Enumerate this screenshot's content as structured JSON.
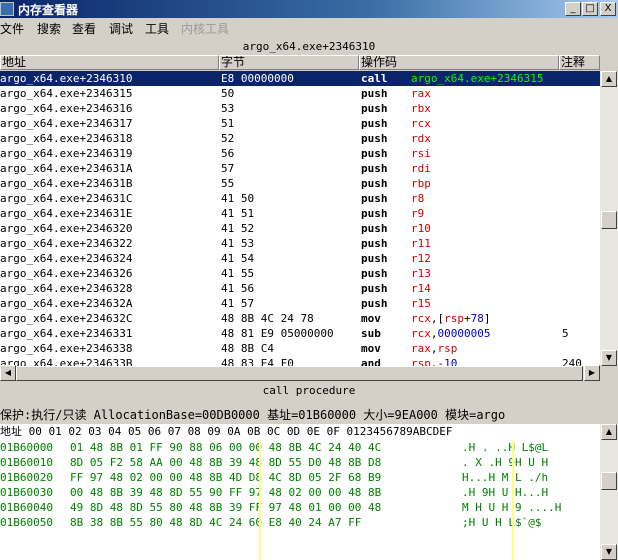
{
  "window": {
    "title": "内存查看器",
    "min": "_",
    "max": "□",
    "close": "X"
  },
  "menu": [
    "文件",
    "搜索",
    "查看",
    "调试",
    "工具",
    "内核工具"
  ],
  "disasm": {
    "header": "argo_x64.exe+2346310",
    "columns": {
      "address": "地址",
      "bytes": "字节",
      "opcode": "操作码",
      "comment": "注释"
    },
    "rows": [
      {
        "addr": "argo_x64.exe+2346310",
        "bytes": "E8 00000000",
        "op": "call",
        "args": [
          {
            "t": "argo_x64.exe+2346315",
            "k": "sel"
          }
        ],
        "cmt": ""
      },
      {
        "addr": "argo_x64.exe+2346315",
        "bytes": "50",
        "op": "push",
        "args": [
          {
            "t": "rax",
            "k": "reg"
          }
        ],
        "cmt": ""
      },
      {
        "addr": "argo_x64.exe+2346316",
        "bytes": "53",
        "op": "push",
        "args": [
          {
            "t": "rbx",
            "k": "reg"
          }
        ],
        "cmt": ""
      },
      {
        "addr": "argo_x64.exe+2346317",
        "bytes": "51",
        "op": "push",
        "args": [
          {
            "t": "rcx",
            "k": "reg"
          }
        ],
        "cmt": ""
      },
      {
        "addr": "argo_x64.exe+2346318",
        "bytes": "52",
        "op": "push",
        "args": [
          {
            "t": "rdx",
            "k": "reg"
          }
        ],
        "cmt": ""
      },
      {
        "addr": "argo_x64.exe+2346319",
        "bytes": "56",
        "op": "push",
        "args": [
          {
            "t": "rsi",
            "k": "reg"
          }
        ],
        "cmt": ""
      },
      {
        "addr": "argo_x64.exe+234631A",
        "bytes": "57",
        "op": "push",
        "args": [
          {
            "t": "rdi",
            "k": "reg"
          }
        ],
        "cmt": ""
      },
      {
        "addr": "argo_x64.exe+234631B",
        "bytes": "55",
        "op": "push",
        "args": [
          {
            "t": "rbp",
            "k": "reg"
          }
        ],
        "cmt": ""
      },
      {
        "addr": "argo_x64.exe+234631C",
        "bytes": "41 50",
        "op": "push",
        "args": [
          {
            "t": "r8",
            "k": "reg"
          }
        ],
        "cmt": ""
      },
      {
        "addr": "argo_x64.exe+234631E",
        "bytes": "41 51",
        "op": "push",
        "args": [
          {
            "t": "r9",
            "k": "reg"
          }
        ],
        "cmt": ""
      },
      {
        "addr": "argo_x64.exe+2346320",
        "bytes": "41 52",
        "op": "push",
        "args": [
          {
            "t": "r10",
            "k": "reg"
          }
        ],
        "cmt": ""
      },
      {
        "addr": "argo_x64.exe+2346322",
        "bytes": "41 53",
        "op": "push",
        "args": [
          {
            "t": "r11",
            "k": "reg"
          }
        ],
        "cmt": ""
      },
      {
        "addr": "argo_x64.exe+2346324",
        "bytes": "41 54",
        "op": "push",
        "args": [
          {
            "t": "r12",
            "k": "reg"
          }
        ],
        "cmt": ""
      },
      {
        "addr": "argo_x64.exe+2346326",
        "bytes": "41 55",
        "op": "push",
        "args": [
          {
            "t": "r13",
            "k": "reg"
          }
        ],
        "cmt": ""
      },
      {
        "addr": "argo_x64.exe+2346328",
        "bytes": "41 56",
        "op": "push",
        "args": [
          {
            "t": "r14",
            "k": "reg"
          }
        ],
        "cmt": ""
      },
      {
        "addr": "argo_x64.exe+234632A",
        "bytes": "41 57",
        "op": "push",
        "args": [
          {
            "t": "r15",
            "k": "reg"
          }
        ],
        "cmt": ""
      },
      {
        "addr": "argo_x64.exe+234632C",
        "bytes": "48 8B 4C 24 78",
        "op": "mov",
        "args": [
          {
            "t": "rcx",
            "k": "reg"
          },
          {
            "t": ",[",
            "k": ""
          },
          {
            "t": "rsp",
            "k": "reg"
          },
          {
            "t": "+",
            "k": ""
          },
          {
            "t": "78",
            "k": "num"
          },
          {
            "t": "]",
            "k": ""
          }
        ],
        "cmt": ""
      },
      {
        "addr": "argo_x64.exe+2346331",
        "bytes": "48 81 E9 05000000",
        "op": "sub",
        "args": [
          {
            "t": "rcx",
            "k": "reg"
          },
          {
            "t": ",",
            "k": ""
          },
          {
            "t": "00000005",
            "k": "num"
          }
        ],
        "cmt": "5"
      },
      {
        "addr": "argo_x64.exe+2346338",
        "bytes": "48 8B C4",
        "op": "mov",
        "args": [
          {
            "t": "rax",
            "k": "reg"
          },
          {
            "t": ",",
            "k": ""
          },
          {
            "t": "rsp",
            "k": "reg"
          }
        ],
        "cmt": ""
      },
      {
        "addr": "argo_x64.exe+234633B",
        "bytes": "48 83 E4 F0",
        "op": "and",
        "args": [
          {
            "t": "rsp",
            "k": "reg"
          },
          {
            "t": ",",
            "k": ""
          },
          {
            "t": "-10",
            "k": "num"
          }
        ],
        "cmt": "240"
      }
    ]
  },
  "status": {
    "call_procedure": "call procedure"
  },
  "info": {
    "text": "保护:执行/只读  AllocationBase=00DB0000 基址=01B60000 大小=9EA000 模块=argo"
  },
  "hex": {
    "header": "地址     00 01 02 03 04 05 06 07 08 09 0A 0B 0C 0D 0E 0F 0123456789ABCDEF",
    "rows": [
      {
        "addr": "01B60000",
        "bytes": "01 48 8B 01 FF 90 88 06 00 00 48 8B 4C 24 40 4C",
        "ascii": " .H .     ..H L$@L"
      },
      {
        "addr": "01B60010",
        "bytes": "8D 05 F2 58 AA 00 48 8B 39 48 8D 55 D0 48 8B D8",
        "ascii": ". X .H 9H U H"
      },
      {
        "addr": "01B60020",
        "bytes": "FF 97 48 02 00 00 48 8B 4D D8 4C 8D 05 2F 68 B9",
        "ascii": "H...H M L ./h"
      },
      {
        "addr": "01B60030",
        "bytes": "00 48 8B 39 48 8D 55 90 FF 97 48 02 00 00 48 8B",
        "ascii": ".H 9H U    H...H"
      },
      {
        "addr": "01B60040",
        "bytes": "49 8D 48 8D 55 80 48 8B 39 FF 97 48 01 00 00 48",
        "ascii": "M H U H 9  ....H"
      },
      {
        "addr": "01B60050",
        "bytes": "8B 38 8B 55 80 48 8D 4C 24 60 E8 40 24 A7 FF",
        "ascii": ";H U H L$`@$"
      }
    ]
  }
}
